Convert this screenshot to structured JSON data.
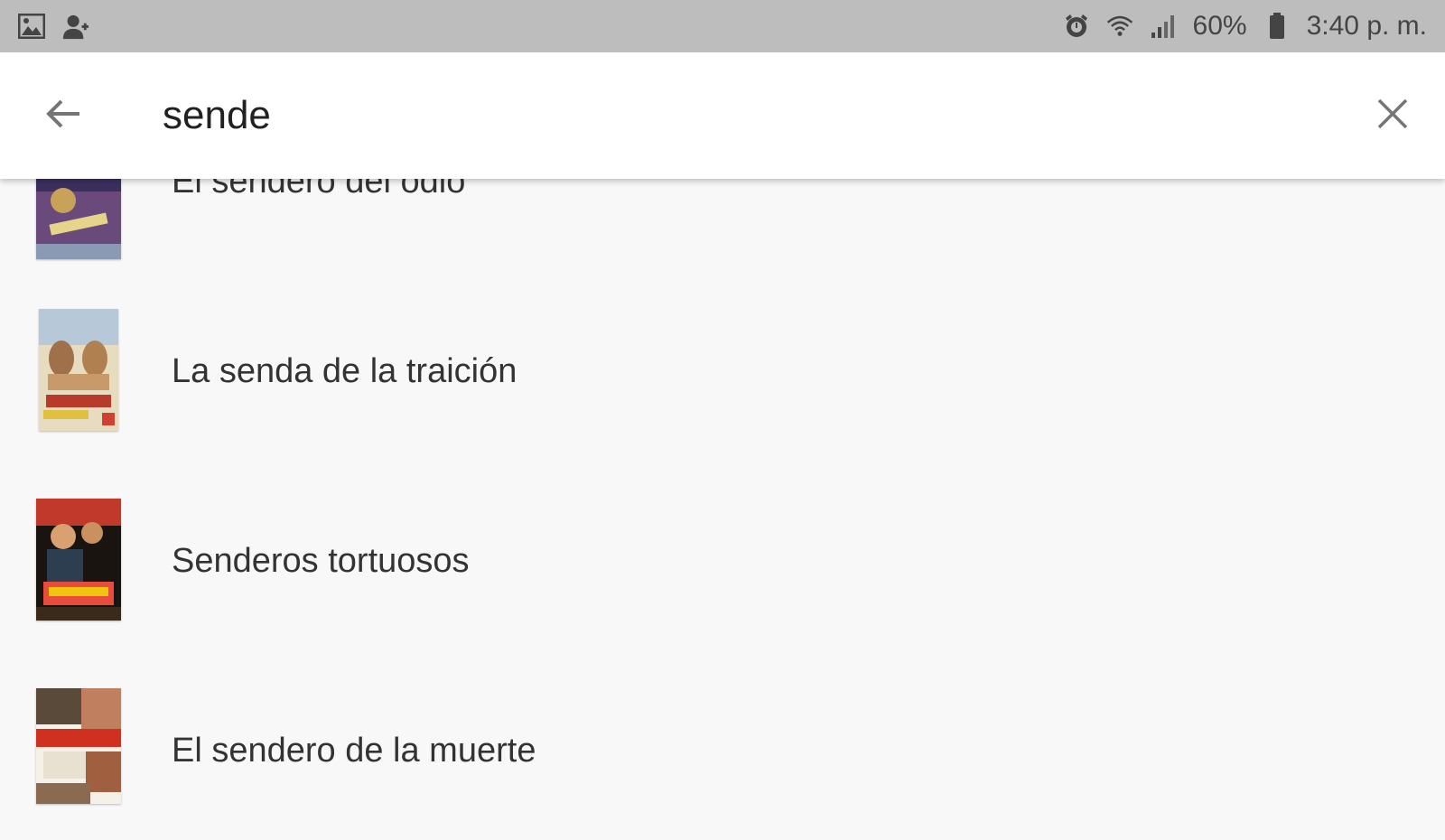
{
  "status_bar": {
    "left_icons": [
      "image-icon",
      "person-add-icon"
    ],
    "right_icons": [
      "alarm-icon",
      "wifi-icon",
      "signal-icon",
      "battery-icon"
    ],
    "battery_percent": "60%",
    "time": "3:40 p. m."
  },
  "search": {
    "query": "sende",
    "back_icon": "arrow-left-icon",
    "clear_icon": "close-icon"
  },
  "results": [
    {
      "title": "El sendero del odio"
    },
    {
      "title": "La senda de la traición"
    },
    {
      "title": "Senderos tortuosos"
    },
    {
      "title": "El sendero de la muerte"
    }
  ]
}
